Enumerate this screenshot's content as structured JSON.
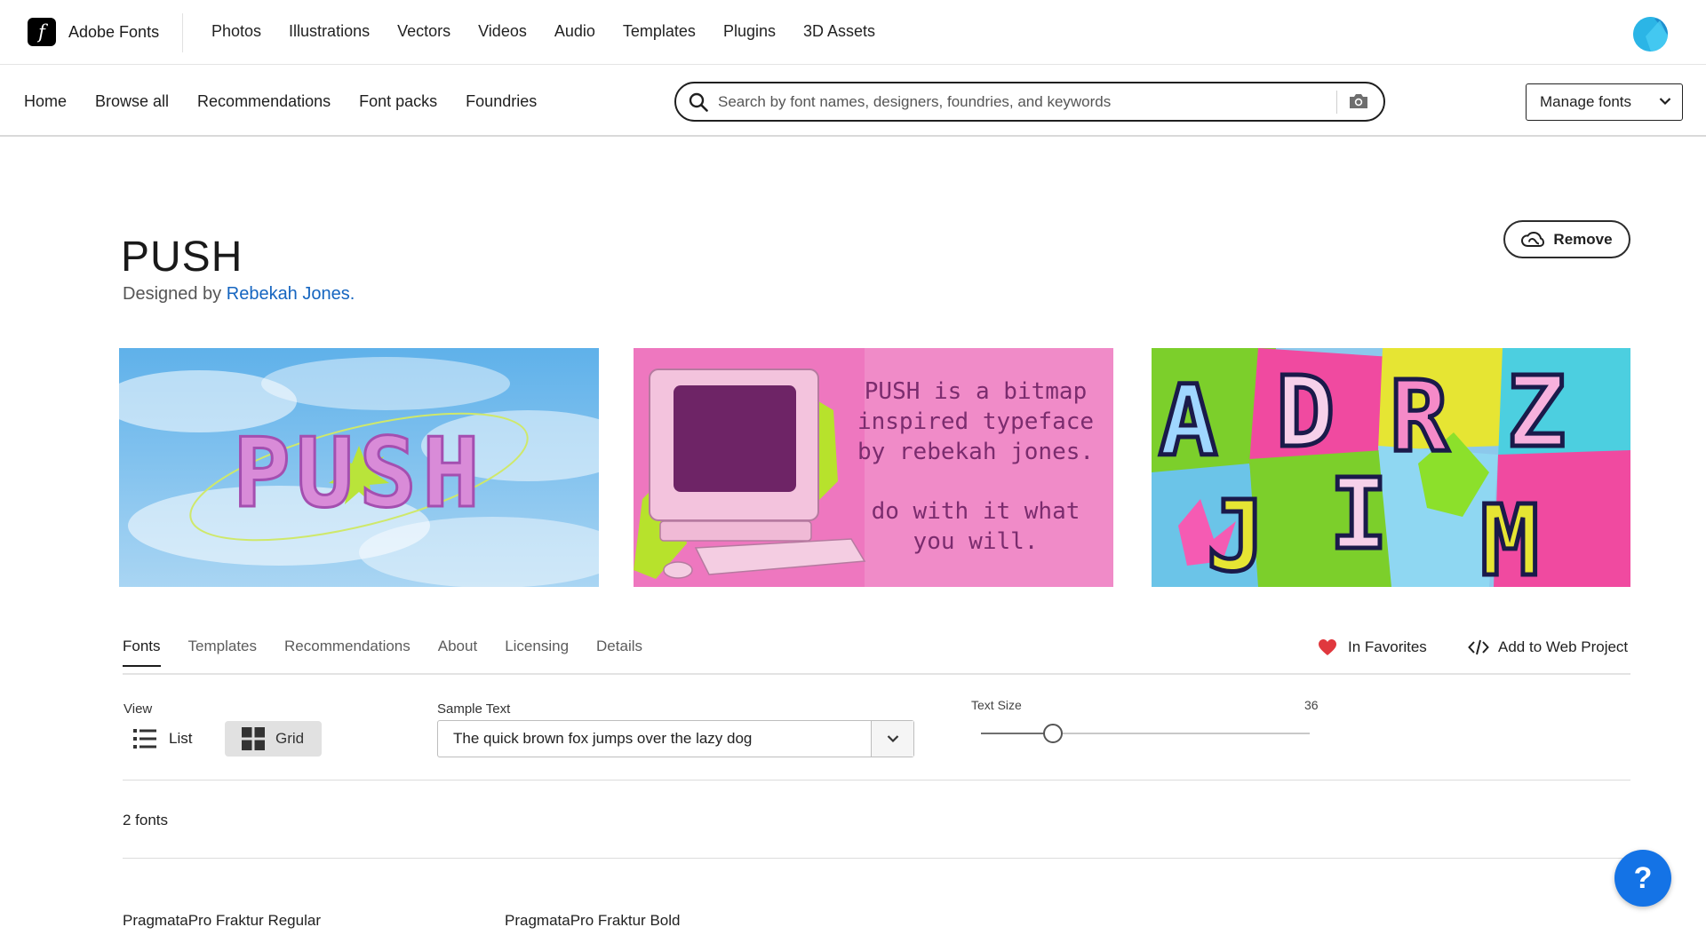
{
  "brand": {
    "name": "Adobe Fonts",
    "logo_letter": "f"
  },
  "top_nav": [
    "Photos",
    "Illustrations",
    "Vectors",
    "Videos",
    "Audio",
    "Templates",
    "Plugins",
    "3D Assets"
  ],
  "sub_nav": [
    "Home",
    "Browse all",
    "Recommendations",
    "Font packs",
    "Foundries"
  ],
  "search": {
    "placeholder": "Search by font names, designers, foundries, and keywords"
  },
  "manage_fonts": {
    "label": "Manage fonts"
  },
  "font": {
    "title": "PUSH",
    "designed_by_prefix": "Designed by",
    "designer": "Rebekah Jones.",
    "remove_label": "Remove"
  },
  "banners": {
    "one": {
      "word": "PUSH"
    },
    "two": {
      "lines": [
        "PUSH is a bitmap",
        "inspired typeface",
        "by rebekah jones.",
        "",
        "do with it what",
        "you will."
      ]
    },
    "three": {
      "letters": [
        "A",
        "D",
        "R",
        "Z",
        "J",
        "I",
        "M"
      ]
    }
  },
  "tabs": [
    {
      "label": "Fonts",
      "active": true
    },
    {
      "label": "Templates",
      "active": false
    },
    {
      "label": "Recommendations",
      "active": false
    },
    {
      "label": "About",
      "active": false
    },
    {
      "label": "Licensing",
      "active": false
    },
    {
      "label": "Details",
      "active": false
    }
  ],
  "actions": {
    "favorites": "In Favorites",
    "web_project": "Add to Web Project"
  },
  "controls": {
    "view_label": "View",
    "list_label": "List",
    "grid_label": "Grid",
    "sample_text_label": "Sample Text",
    "sample_text_value": "The quick brown fox jumps over the lazy dog",
    "text_size_label": "Text Size",
    "text_size_value": "36",
    "text_size_fraction": 0.22
  },
  "font_count": "2 fonts",
  "font_names": [
    "PragmataPro Fraktur Regular",
    "PragmataPro Fraktur Bold"
  ],
  "help": {
    "label": "?"
  },
  "colors": {
    "accent_blue": "#1473e6",
    "link_blue": "#1565c0",
    "heart_red": "#e0383e",
    "avatar_cyan": "#29b6e8"
  }
}
